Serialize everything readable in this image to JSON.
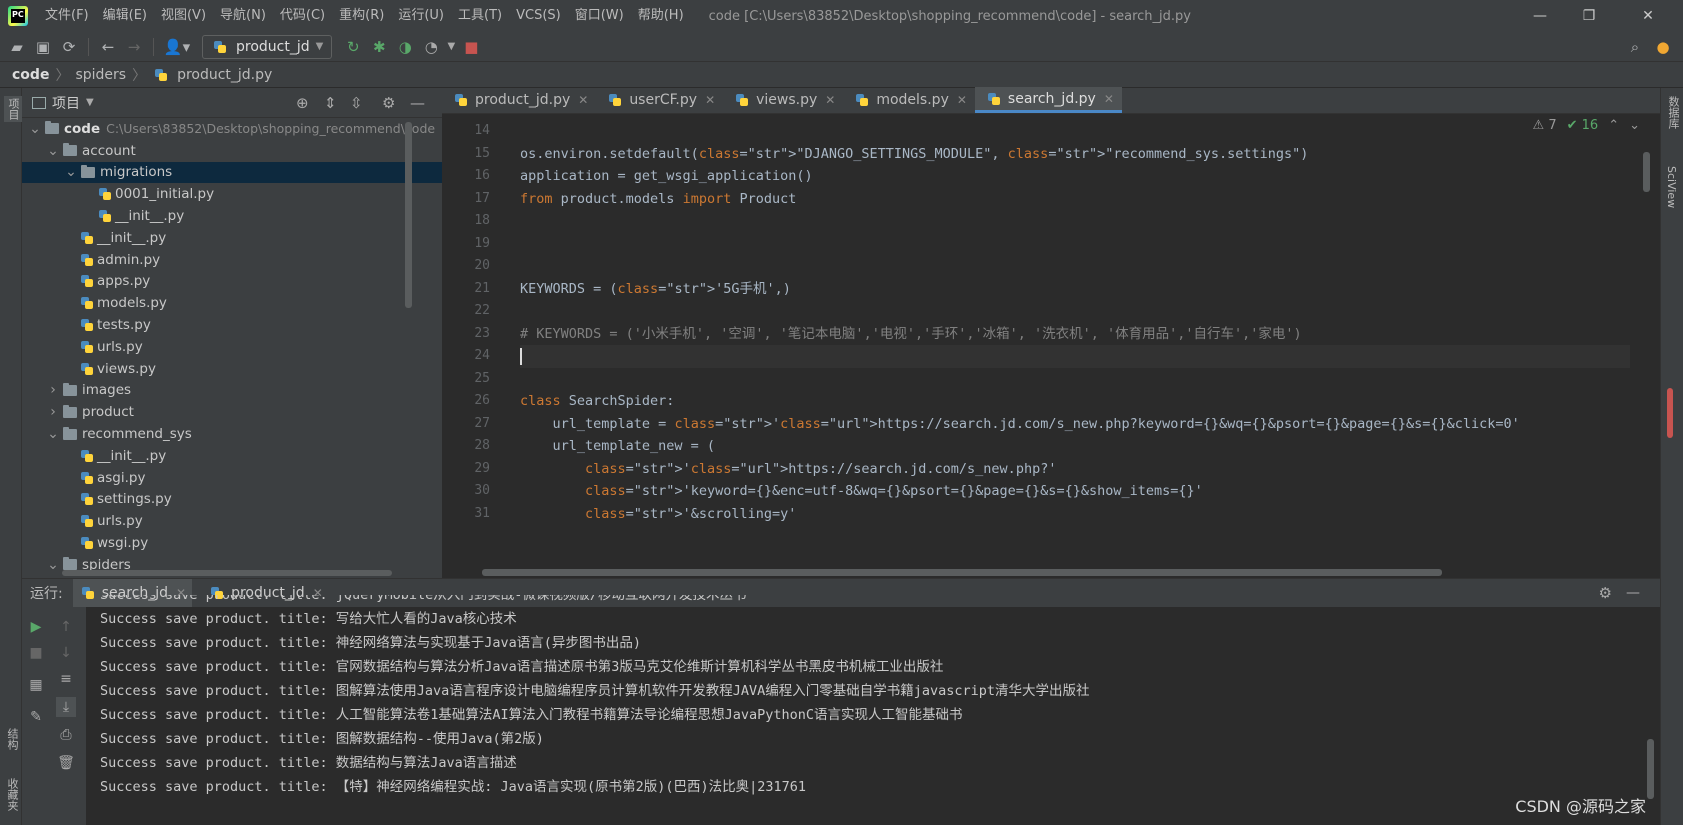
{
  "app": {
    "menu": [
      "文件(F)",
      "编辑(E)",
      "视图(V)",
      "导航(N)",
      "代码(C)",
      "重构(R)",
      "运行(U)",
      "工具(T)",
      "VCS(S)",
      "窗口(W)",
      "帮助(H)"
    ],
    "window_title": "code [C:\\Users\\83852\\Desktop\\shopping_recommend\\code] - search_jd.py"
  },
  "toolbar": {
    "run_config": "product_jd"
  },
  "breadcrumb": [
    "code",
    "spiders",
    "product_jd.py"
  ],
  "left_strip": {
    "project_label": "项目",
    "structure_label": "结构",
    "favorites_label": "收藏夹"
  },
  "right_strip": {
    "database_label": "数据库",
    "sciview_label": "SciView"
  },
  "project": {
    "header": "项目",
    "tree": [
      {
        "label": "code",
        "hint": "C:\\Users\\83852\\Desktop\\shopping_recommend\\code",
        "type": "folder",
        "depth": 0,
        "open": true
      },
      {
        "label": "account",
        "type": "folder",
        "depth": 1,
        "open": true
      },
      {
        "label": "migrations",
        "type": "folder",
        "depth": 2,
        "open": true,
        "selected": true
      },
      {
        "label": "0001_initial.py",
        "type": "py",
        "depth": 3
      },
      {
        "label": "__init__.py",
        "type": "py",
        "depth": 3
      },
      {
        "label": "__init__.py",
        "type": "py",
        "depth": 2
      },
      {
        "label": "admin.py",
        "type": "py",
        "depth": 2
      },
      {
        "label": "apps.py",
        "type": "py",
        "depth": 2
      },
      {
        "label": "models.py",
        "type": "py",
        "depth": 2
      },
      {
        "label": "tests.py",
        "type": "py",
        "depth": 2
      },
      {
        "label": "urls.py",
        "type": "py",
        "depth": 2
      },
      {
        "label": "views.py",
        "type": "py",
        "depth": 2
      },
      {
        "label": "images",
        "type": "folder",
        "depth": 1,
        "open": false
      },
      {
        "label": "product",
        "type": "folder",
        "depth": 1,
        "open": false
      },
      {
        "label": "recommend_sys",
        "type": "folder",
        "depth": 1,
        "open": true
      },
      {
        "label": "__init__.py",
        "type": "py",
        "depth": 2
      },
      {
        "label": "asgi.py",
        "type": "py",
        "depth": 2
      },
      {
        "label": "settings.py",
        "type": "py",
        "depth": 2
      },
      {
        "label": "urls.py",
        "type": "py",
        "depth": 2
      },
      {
        "label": "wsgi.py",
        "type": "py",
        "depth": 2
      },
      {
        "label": "spiders",
        "type": "folder",
        "depth": 1,
        "open": true
      }
    ]
  },
  "editor": {
    "tabs": [
      {
        "label": "product_jd.py",
        "active": false
      },
      {
        "label": "userCF.py",
        "active": false
      },
      {
        "label": "views.py",
        "active": false
      },
      {
        "label": "models.py",
        "active": false
      },
      {
        "label": "search_jd.py",
        "active": true
      }
    ],
    "inspections": {
      "warnings": "7",
      "ok": "16"
    },
    "line_numbers": [
      "14",
      "15",
      "16",
      "17",
      "18",
      "19",
      "20",
      "21",
      "22",
      "23",
      "24",
      "25",
      "26",
      "27",
      "28",
      "29",
      "30",
      "31"
    ],
    "code": [
      "",
      "os.environ.setdefault(\"DJANGO_SETTINGS_MODULE\", \"recommend_sys.settings\")",
      "application = get_wsgi_application()",
      "from product.models import Product",
      "",
      "",
      "",
      "KEYWORDS = ('5G手机',)",
      "",
      "# KEYWORDS = ('小米手机', '空调', '笔记本电脑','电视','手环','冰箱', '洗衣机', '体育用品','自行车','家电')",
      "",
      "",
      "class SearchSpider:",
      "    url_template = 'https://search.jd.com/s_new.php?keyword={}&wq={}&psort={}&page={}&s={}&click=0'",
      "    url_template_new = (",
      "        'https://search.jd.com/s_new.php?'",
      "        'keyword={}&enc=utf-8&wq={}&psort={}&page={}&s={}&show_items={}'",
      "        '&scrolling=y'"
    ]
  },
  "run": {
    "label": "运行:",
    "tabs": [
      {
        "label": "search_jd",
        "active": true
      },
      {
        "label": "product_jd",
        "active": false
      }
    ],
    "console": [
      "Success save product. title: jQueryMobile从入门到实战-微课视频版/移动互联网开发技术丛书",
      "Success save product. title: 写给大忙人看的Java核心技术",
      "Success save product. title: 神经网络算法与实现基于Java语言(异步图书出品)",
      "Success save product. title: 官网数据结构与算法分析Java语言描述原书第3版马克艾伦维斯计算机科学丛书黑皮书机械工业出版社",
      "Success save product. title: 图解算法使用Java语言程序设计电脑编程序员计算机软件开发教程JAVA编程入门零基础自学书籍javascript清华大学出版社",
      "Success save product. title: 人工智能算法卷1基础算法AI算法入门教程书籍算法导论编程思想JavaPythonC语言实现人工智能基础书",
      "Success save product. title: 图解数据结构--使用Java(第2版)",
      "Success save product. title: 数据结构与算法Java语言描述",
      "Success save product. title: 【特】神经网络编程实战: Java语言实现(原书第2版)(巴西)法比奥|231761"
    ]
  },
  "watermark": "CSDN @源码之家"
}
